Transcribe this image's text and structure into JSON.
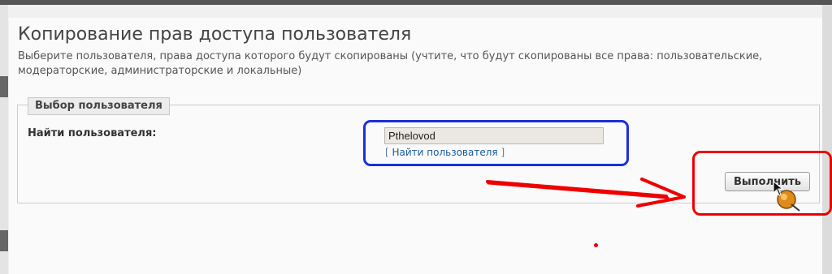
{
  "page": {
    "title": "Копирование прав доступа пользователя",
    "description": "Выберите пользователя, права доступа которого будут скопированы (учтите, что будут скопированы все права: пользовательские, модераторские, администраторские и локальные)"
  },
  "user_select": {
    "legend": "Выбор пользователя",
    "find_label": "Найти пользователя:",
    "username_value": "Pthelovod",
    "find_link_open": "[ ",
    "find_link_text": "Найти пользователя",
    "find_link_close": " ]"
  },
  "actions": {
    "execute_label": "Выполнить"
  },
  "annotations": {
    "blue_highlight_color": "#1c2fd8",
    "red_highlight_color": "#ee0000"
  },
  "icons": {
    "cursor": "hand-pointer-icon"
  }
}
